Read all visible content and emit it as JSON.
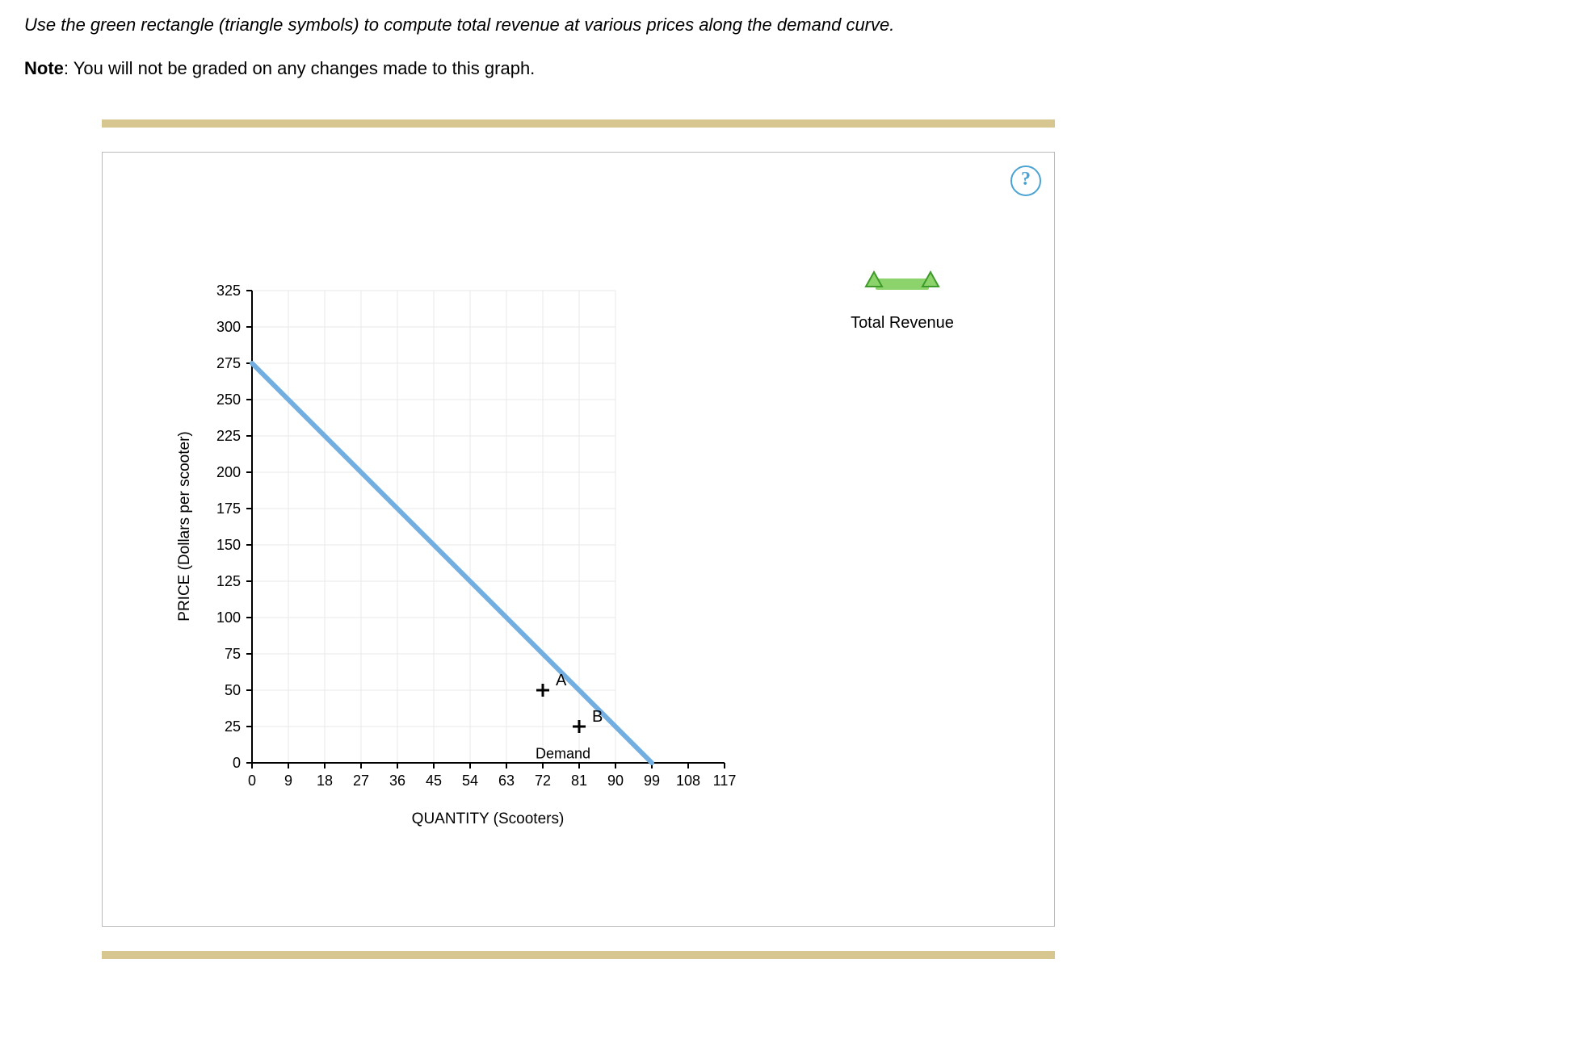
{
  "instruction": "Use the green rectangle (triangle symbols) to compute total revenue at various prices along the demand curve.",
  "note_label": "Note",
  "note_text": ": You will not be graded on any changes made to this graph.",
  "help_symbol": "?",
  "legend": {
    "title": "Total Revenue"
  },
  "chart_data": {
    "type": "line",
    "title": "",
    "xlabel": "QUANTITY (Scooters)",
    "ylabel": "PRICE (Dollars per scooter)",
    "xlim": [
      0,
      117
    ],
    "ylim": [
      0,
      325
    ],
    "x_ticks": [
      0,
      9,
      18,
      27,
      36,
      45,
      54,
      63,
      72,
      81,
      90,
      99,
      108,
      117
    ],
    "y_ticks": [
      0,
      25,
      50,
      75,
      100,
      125,
      150,
      175,
      200,
      225,
      250,
      275,
      300,
      325
    ],
    "grid": true,
    "series": [
      {
        "name": "Demand",
        "x": [
          0,
          99
        ],
        "y": [
          275,
          0
        ],
        "color": "#73aee0"
      }
    ],
    "points": [
      {
        "name": "A",
        "x": 72,
        "y": 50
      },
      {
        "name": "B",
        "x": 81,
        "y": 25
      }
    ],
    "tools": [
      {
        "name": "Total Revenue",
        "type": "rectangle",
        "color": "#8bd36a"
      }
    ]
  }
}
